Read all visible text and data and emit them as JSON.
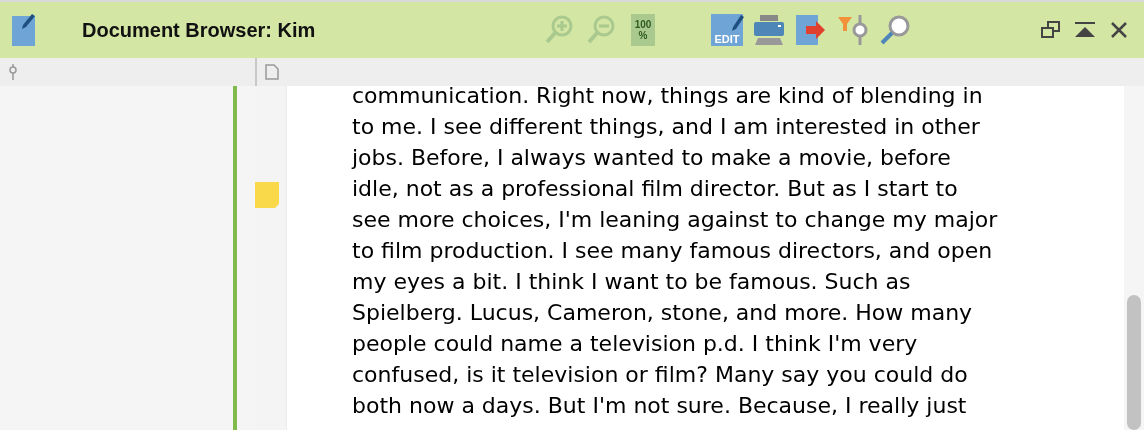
{
  "window": {
    "title": "Document Browser: Kim"
  },
  "toolbar": [
    {
      "kind": "zoom-in",
      "disabled": true
    },
    {
      "kind": "zoom-out",
      "disabled": true
    },
    {
      "kind": "zoom-reset",
      "disabled": true,
      "label": "100 %"
    },
    {
      "kind": "edit",
      "label": "EDIT"
    },
    {
      "kind": "print"
    },
    {
      "kind": "export"
    },
    {
      "kind": "filter"
    },
    {
      "kind": "search"
    }
  ],
  "window_controls": [
    {
      "kind": "restore"
    },
    {
      "kind": "collapse"
    },
    {
      "kind": "close"
    }
  ],
  "document": {
    "lines": [
      {
        "text": "communication.  Right now, things are kind of blending in",
        "memo": false
      },
      {
        "text": "to me.  I see different things, and I am interested in other",
        "memo": false
      },
      {
        "text": "jobs.  Before, I always wanted to make a movie, before",
        "memo": false
      },
      {
        "text": "idle, not as a professional film director.  But as I start to",
        "memo": true
      },
      {
        "text": "see more choices, I'm leaning against to change my major",
        "memo": false
      },
      {
        "text": "to film production. I see many famous directors, and open",
        "memo": false
      },
      {
        "text": "my eyes a bit.  I think I want to be famous.  Such as",
        "memo": false
      },
      {
        "text": "Spielberg. Lucus, Cameron, stone, and more.  How many",
        "memo": false
      },
      {
        "text": "people could name a television p.d. I think I'm very",
        "memo": false
      },
      {
        "text": "confused, is it television or film?  Many say you could do",
        "memo": false
      },
      {
        "text": "both now a days. But I'm not sure.  Because, I really just",
        "memo": false
      }
    ]
  }
}
